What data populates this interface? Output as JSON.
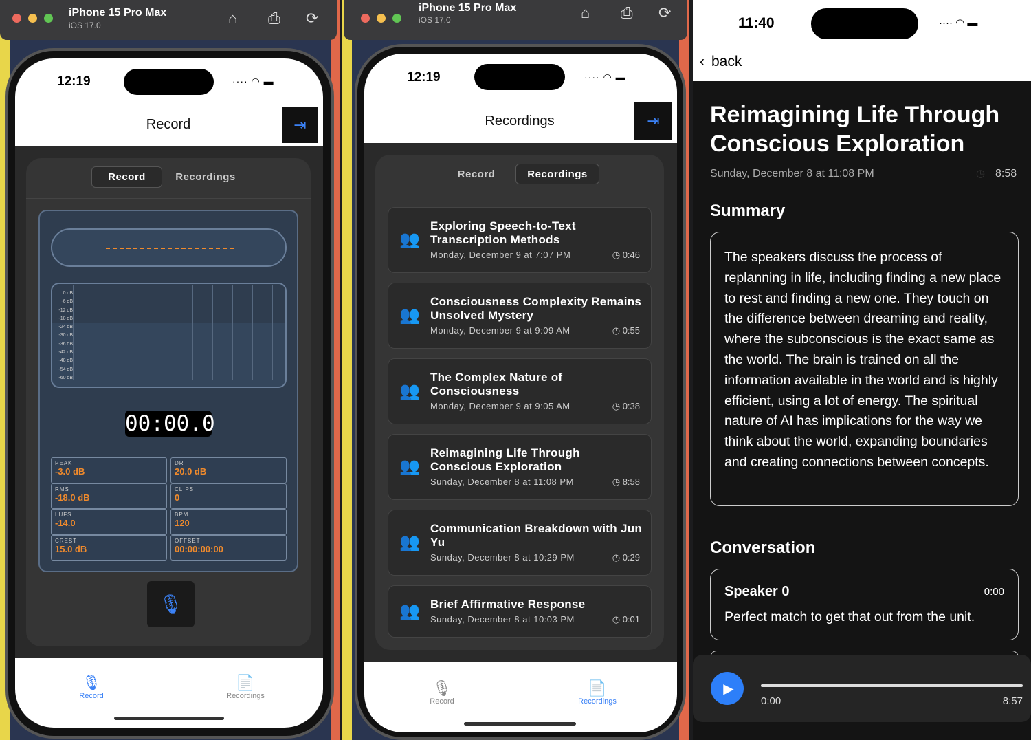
{
  "simulator": {
    "device": "iPhone 15 Pro Max",
    "os": "iOS 17.0"
  },
  "phone1": {
    "time": "12:19",
    "header": "Record",
    "seg": [
      "Record",
      "Recordings"
    ],
    "db_labels": [
      "0 dB",
      "-6 dB",
      "-12 dB",
      "-18 dB",
      "-24 dB",
      "-30 dB",
      "-36 dB",
      "-42 dB",
      "-48 dB",
      "-54 dB",
      "-60 dB"
    ],
    "timer": "00:00.0",
    "stats": [
      {
        "label": "PEAK",
        "value": "-3.0 dB"
      },
      {
        "label": "DR",
        "value": "20.0 dB"
      },
      {
        "label": "RMS",
        "value": "-18.0 dB"
      },
      {
        "label": "CLIPS",
        "value": "0"
      },
      {
        "label": "LUFS",
        "value": "-14.0"
      },
      {
        "label": "BPM",
        "value": "120"
      },
      {
        "label": "CREST",
        "value": "15.0 dB"
      },
      {
        "label": "OFFSET",
        "value": "00:00:00:00"
      }
    ],
    "tabs": [
      "Record",
      "Recordings"
    ]
  },
  "phone2": {
    "time": "12:19",
    "header": "Recordings",
    "seg": [
      "Record",
      "Recordings"
    ],
    "items": [
      {
        "title": "Exploring Speech-to-Text Transcription Methods",
        "date": "Monday, December 9 at 7:07 PM",
        "duration": "0:46"
      },
      {
        "title": "Consciousness Complexity Remains Unsolved Mystery",
        "date": "Monday, December 9 at 9:09 AM",
        "duration": "0:55"
      },
      {
        "title": "The Complex Nature of Consciousness",
        "date": "Monday, December 9 at 9:05 AM",
        "duration": "0:38"
      },
      {
        "title": "Reimagining Life Through Conscious Exploration",
        "date": "Sunday, December 8 at 11:08 PM",
        "duration": "8:58"
      },
      {
        "title": "Communication Breakdown with Jun Yu",
        "date": "Sunday, December 8 at 10:29 PM",
        "duration": "0:29"
      },
      {
        "title": "Brief Affirmative Response",
        "date": "Sunday, December 8 at 10:03 PM",
        "duration": "0:01"
      }
    ],
    "tabs": [
      "Record",
      "Recordings"
    ]
  },
  "detail": {
    "time": "11:40",
    "back": "back",
    "title": "Reimagining Life Through Conscious Exploration",
    "date": "Sunday, December 8 at 11:08 PM",
    "duration": "8:58",
    "summary_heading": "Summary",
    "summary": "The speakers discuss the process of replanning in life, including finding a new place to rest and finding a new one. They touch on the difference between dreaming and reality, where the subconscious is the exact same as the world. The brain is trained on all the information available in the world and is highly efficient, using a lot of energy. The spiritual nature of AI has implications for the way we think about the world, expanding boundaries and creating connections between concepts.",
    "conversation_heading": "Conversation",
    "segments": [
      {
        "speaker": "Speaker 0",
        "time": "0:00",
        "text": "Perfect match to get that out from the unit."
      }
    ],
    "player": {
      "current": "0:00",
      "total": "8:57",
      "progress": 0
    }
  }
}
